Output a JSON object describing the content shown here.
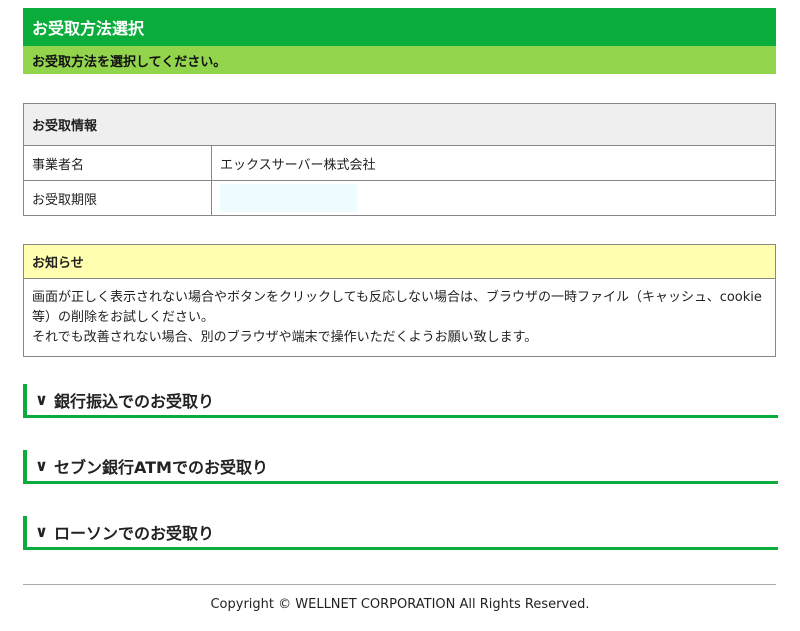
{
  "header": {
    "title": "お受取方法選択",
    "subtitle": "お受取方法を選択してください。"
  },
  "info": {
    "heading": "お受取情報",
    "rows": [
      {
        "label": "事業者名",
        "value": "エックスサーバー株式会社"
      },
      {
        "label": "お受取期限",
        "value": ""
      }
    ]
  },
  "notice": {
    "heading": "お知らせ",
    "line1": "画面が正しく表示されない場合やボタンをクリックしても反応しない場合は、ブラウザの一時ファイル（キャッシュ、cookie等）の削除をお試しください。",
    "line2": "それでも改善されない場合、別のブラウザや端末で操作いただくようお願い致します。"
  },
  "methods": [
    {
      "chevron": "∨",
      "label": "銀行振込でのお受取り"
    },
    {
      "chevron": "∨",
      "label": "セブン銀行ATMでのお受取り"
    },
    {
      "chevron": "∨",
      "label": "ローソンでのお受取り"
    }
  ],
  "footer": {
    "copyright": "Copyright © WELLNET CORPORATION All Rights Reserved."
  },
  "colors": {
    "primary_green": "#0aac3b",
    "light_green": "#92d44c",
    "notice_yellow": "#ffffaf"
  }
}
